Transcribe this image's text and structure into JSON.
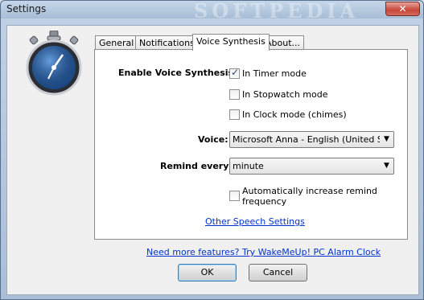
{
  "window": {
    "title": "Settings",
    "watermark": "SOFTPEDIA",
    "close_glyph": "✕"
  },
  "tabs": [
    {
      "label": "General",
      "active": false
    },
    {
      "label": "Notifications",
      "active": false
    },
    {
      "label": "Voice Synthesis",
      "active": true
    },
    {
      "label": "About...",
      "active": false
    }
  ],
  "voice_synthesis": {
    "enable_label": "Enable Voice Synthesis:",
    "modes": [
      {
        "label": "In Timer mode",
        "checked": true
      },
      {
        "label": "In Stopwatch mode",
        "checked": false
      },
      {
        "label": "In Clock mode (chimes)",
        "checked": false
      }
    ],
    "voice_label": "Voice:",
    "voice_value": "Microsoft Anna - English (United States)",
    "remind_label": "Remind every",
    "remind_value": "minute",
    "auto_increase_label_line1": "Automatically increase remind",
    "auto_increase_label_line2": "frequency",
    "auto_increase_checked": false,
    "other_settings_link": "Other Speech Settings"
  },
  "footer": {
    "promo_link": "Need more features? Try WakeMeUp! PC Alarm Clock",
    "ok_label": "OK",
    "cancel_label": "Cancel"
  },
  "icons": {
    "app_icon": "stopwatch-icon",
    "dropdown_arrow": "▼",
    "checkmark": "✓"
  }
}
